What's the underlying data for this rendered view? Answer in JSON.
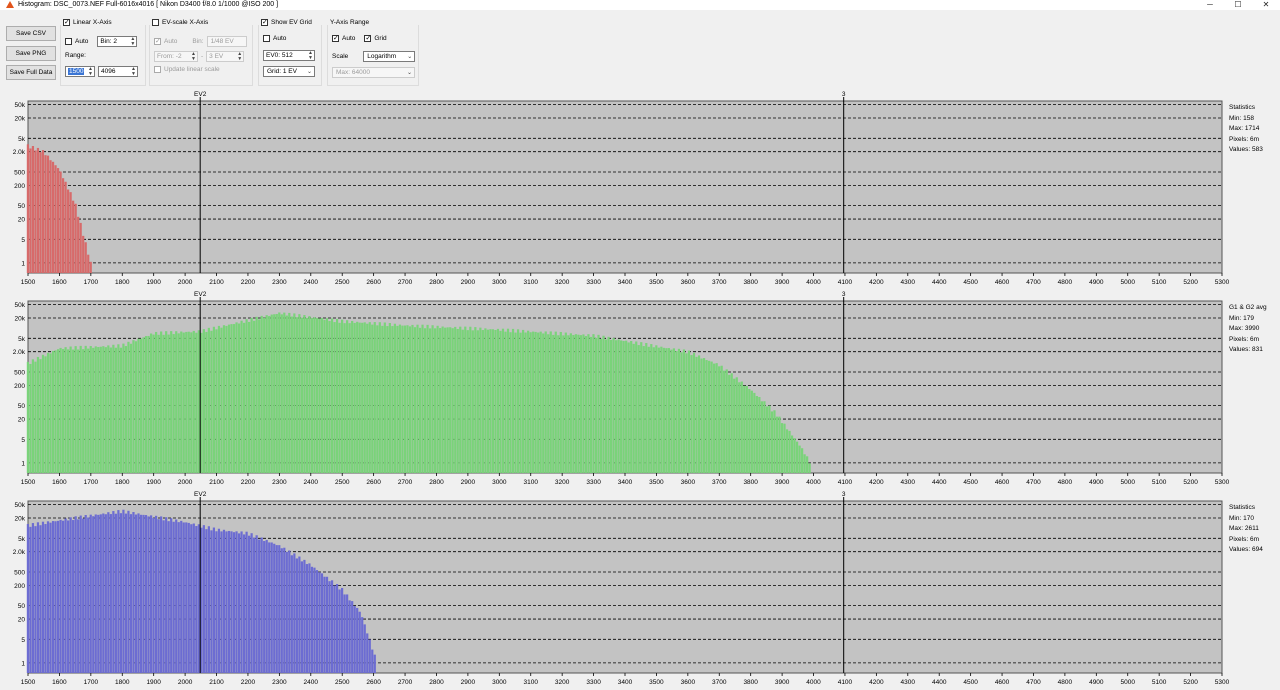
{
  "window": {
    "title": "Histogram: DSC_0073.NEF Full-6016x4016 [ Nikon D3400 f/8.0 1/1000 @ISO 200 ]",
    "controls": [
      "─",
      "☐",
      "✕"
    ]
  },
  "toolbar": {
    "buttons": [
      "Save CSV",
      "Save PNG",
      "Save Full Data"
    ],
    "linear": {
      "label": "Linear X-Axis",
      "checked": true,
      "auto_label": "Auto",
      "auto_checked": false,
      "bin_value": "Bin: 2",
      "range_label": "Range:",
      "range_from": "1500",
      "range_to": "4096"
    },
    "ev": {
      "label": "EV-scale X-Axis",
      "checked": false,
      "auto_label": "Auto",
      "auto_checked": true,
      "bin_label": "Bin:",
      "bin_value": "1/48 EV",
      "from_value": "From: -2",
      "dash": "-",
      "to_value": "3 EV",
      "update_label": "Update linear scale"
    },
    "evgrid": {
      "label": "Show EV Grid",
      "checked": true,
      "auto_label": "Auto",
      "auto_checked": false,
      "ev0_value": "EV0: 512",
      "grid_value": "Grid: 1 EV"
    },
    "yaxis": {
      "label": "Y-Axis Range",
      "auto_label": "Auto",
      "auto_checked": true,
      "grid_label": "Grid",
      "grid_checked": true,
      "scale_label": "Scale",
      "scale_value": "Logarithm",
      "max_value": "Max: 64000"
    }
  },
  "colors": {
    "plot_bg": "#c3c3c3",
    "red": "#d76a6a",
    "green": "#7ad37a",
    "blue": "#6c6cd2",
    "grid": "#000000"
  },
  "chart_data": [
    {
      "type": "bar",
      "name": "red",
      "x_ticks": [
        1500,
        1600,
        1700,
        1800,
        1900,
        2000,
        2100,
        2200,
        2300,
        2400,
        2500,
        2600,
        2700,
        2800,
        2900,
        3000,
        3100,
        3200,
        3300,
        3400,
        3500,
        3600,
        3700,
        3800,
        3900,
        4000,
        4100,
        4200,
        4300,
        4400,
        4500,
        4600,
        4700,
        4800,
        4900,
        5000,
        5100,
        5200,
        5300
      ],
      "y_ticks": [
        "50k",
        "20k",
        "5k",
        "2.0k",
        "500",
        "200",
        "50",
        "20",
        "5",
        "1"
      ],
      "ev_markers": [
        {
          "x": 2048,
          "label": "EV2"
        },
        {
          "x": 4096,
          "label": "3"
        }
      ],
      "xlim": [
        1500,
        5300
      ],
      "ylim": [
        0.5,
        64000
      ],
      "y_scale": "log",
      "approx_series": [
        [
          1500,
          3000
        ],
        [
          1550,
          2000
        ],
        [
          1600,
          600
        ],
        [
          1650,
          60
        ],
        [
          1700,
          1
        ]
      ],
      "stats": [
        "Statistics",
        "Min: 158",
        "Max: 1714",
        "Pixels: 6m",
        "Values: 583"
      ]
    },
    {
      "type": "bar",
      "name": "green",
      "x_ticks": [
        1500,
        1600,
        1700,
        1800,
        1900,
        2000,
        2100,
        2200,
        2300,
        2400,
        2500,
        2600,
        2700,
        2800,
        2900,
        3000,
        3100,
        3200,
        3300,
        3400,
        3500,
        3600,
        3700,
        3800,
        3900,
        4000,
        4100,
        4200,
        4300,
        4400,
        4500,
        4600,
        4700,
        4800,
        4900,
        5000,
        5100,
        5200,
        5300
      ],
      "y_ticks": [
        "50k",
        "20k",
        "5k",
        "2.0k",
        "500",
        "200",
        "50",
        "20",
        "5",
        "1"
      ],
      "ev_markers": [
        {
          "x": 2048,
          "label": "EV2"
        },
        {
          "x": 4096,
          "label": "3"
        }
      ],
      "xlim": [
        1500,
        5300
      ],
      "ylim": [
        0.5,
        64000
      ],
      "y_scale": "log",
      "approx_series": [
        [
          1500,
          900
        ],
        [
          1600,
          2500
        ],
        [
          1800,
          3000
        ],
        [
          1900,
          7000
        ],
        [
          2050,
          8000
        ],
        [
          2300,
          28000
        ],
        [
          2500,
          16000
        ],
        [
          2700,
          12000
        ],
        [
          3000,
          9000
        ],
        [
          3300,
          6000
        ],
        [
          3600,
          2000
        ],
        [
          3700,
          800
        ],
        [
          3800,
          150
        ],
        [
          3880,
          30
        ],
        [
          3960,
          3
        ],
        [
          3990,
          1
        ]
      ],
      "stats": [
        "G1 & G2 avg",
        "Min: 179",
        "Max: 3990",
        "Pixels: 6m",
        "Values: 831"
      ]
    },
    {
      "type": "bar",
      "name": "blue",
      "x_ticks": [
        1500,
        1600,
        1700,
        1800,
        1900,
        2000,
        2100,
        2200,
        2300,
        2400,
        2500,
        2600,
        2700,
        2800,
        2900,
        3000,
        3100,
        3200,
        3300,
        3400,
        3500,
        3600,
        3700,
        3800,
        3900,
        4000,
        4100,
        4200,
        4300,
        4400,
        4500,
        4600,
        4700,
        4800,
        4900,
        5000,
        5100,
        5200,
        5300
      ],
      "y_ticks": [
        "50k",
        "20k",
        "5k",
        "2.0k",
        "500",
        "200",
        "50",
        "20",
        "5",
        "1"
      ],
      "ev_markers": [
        {
          "x": 2048,
          "label": "EV2"
        },
        {
          "x": 4096,
          "label": "3"
        }
      ],
      "xlim": [
        1500,
        5300
      ],
      "ylim": [
        0.5,
        64000
      ],
      "y_scale": "log",
      "approx_series": [
        [
          1500,
          12000
        ],
        [
          1650,
          20000
        ],
        [
          1800,
          32000
        ],
        [
          2000,
          15000
        ],
        [
          2100,
          9000
        ],
        [
          2200,
          7000
        ],
        [
          2300,
          3000
        ],
        [
          2400,
          800
        ],
        [
          2500,
          150
        ],
        [
          2560,
          30
        ],
        [
          2611,
          1
        ]
      ],
      "stats": [
        "Statistics",
        "Min: 170",
        "Max: 2611",
        "Pixels: 6m",
        "Values: 694"
      ]
    }
  ]
}
